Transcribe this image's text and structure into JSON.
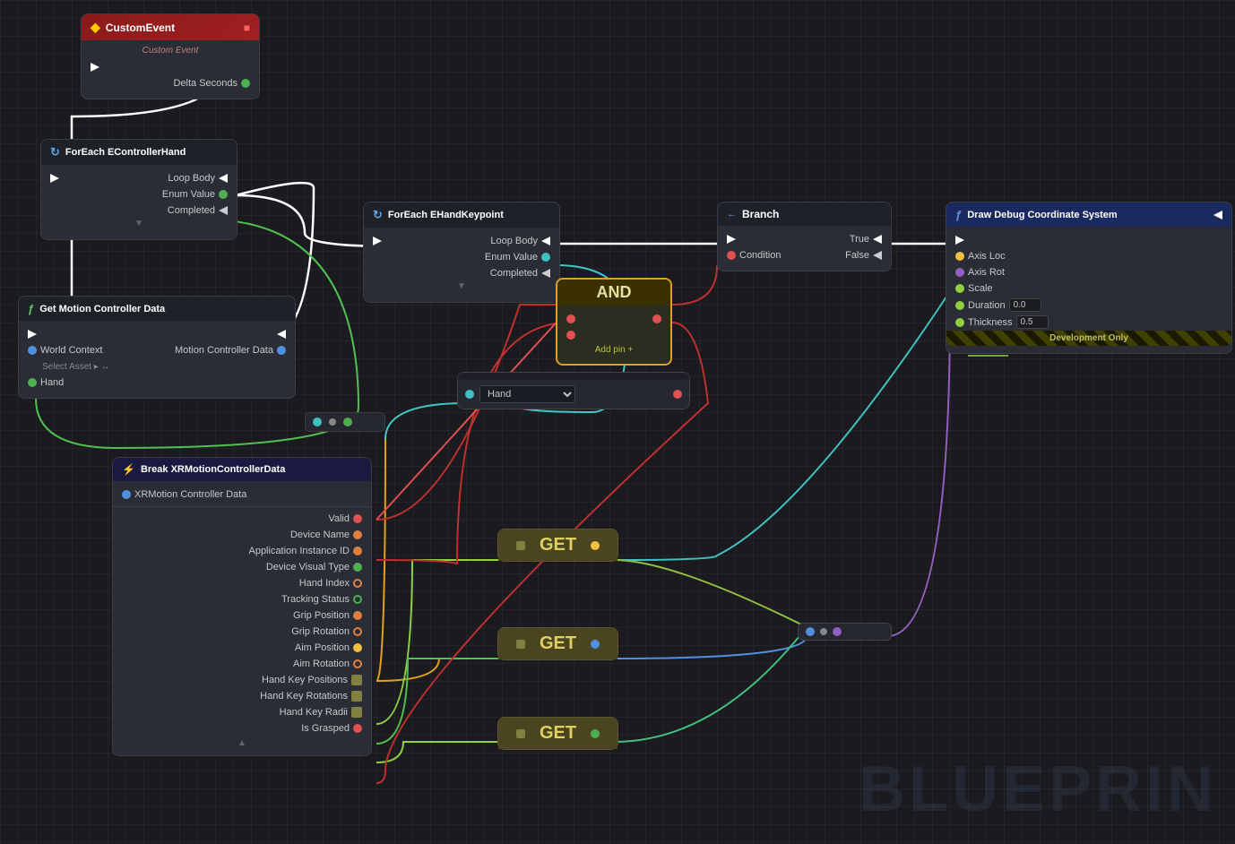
{
  "nodes": {
    "customEvent": {
      "title": "CustomEvent",
      "subtitle": "Custom Event",
      "pins": {
        "out": "▶",
        "deltaSeconds": "Delta Seconds"
      }
    },
    "foreachHand": {
      "title": "ForEach EControllerHand",
      "pins": {
        "loopBody": "Loop Body",
        "enumValue": "Enum Value",
        "completed": "Completed"
      }
    },
    "getMotion": {
      "title": "Get Motion Controller Data",
      "pins": {
        "worldContext": "World Context",
        "selectAsset": "Select Asset ▸ ↔",
        "hand": "Hand",
        "motionControllerData": "Motion Controller Data"
      }
    },
    "foreachKeypoint": {
      "title": "ForEach EHandKeypoint",
      "pins": {
        "loopBody": "Loop Body",
        "enumValue": "Enum Value",
        "completed": "Completed"
      }
    },
    "branch": {
      "title": "Branch",
      "pins": {
        "true": "True",
        "condition": "Condition",
        "false": "False"
      }
    },
    "drawDebug": {
      "title": "Draw Debug Coordinate System",
      "pins": {
        "axisLoc": "Axis Loc",
        "axisRot": "Axis Rot",
        "scale": "Scale",
        "duration": "Duration",
        "durationValue": "0.0",
        "thickness": "Thickness",
        "thicknessValue": "0.5"
      }
    },
    "and": {
      "title": "AND",
      "addPin": "Add pin +"
    },
    "breakXR": {
      "title": "Break XRMotionControllerData",
      "xrLabel": "XRMotion Controller Data",
      "pins": [
        "Valid",
        "Device Name",
        "Application Instance ID",
        "Device Visual Type",
        "Hand Index",
        "Tracking Status",
        "Grip Position",
        "Grip Rotation",
        "Aim Position",
        "Aim Rotation",
        "Hand Key Positions",
        "Hand Key Rotations",
        "Hand Key Radii",
        "Is Grasped"
      ]
    },
    "handSelect": {
      "options": [
        "Hand"
      ]
    },
    "get1": {
      "label": "GET"
    },
    "get2": {
      "label": "GET"
    },
    "get3": {
      "label": "GET"
    }
  },
  "watermark": "BLUEPRIN"
}
